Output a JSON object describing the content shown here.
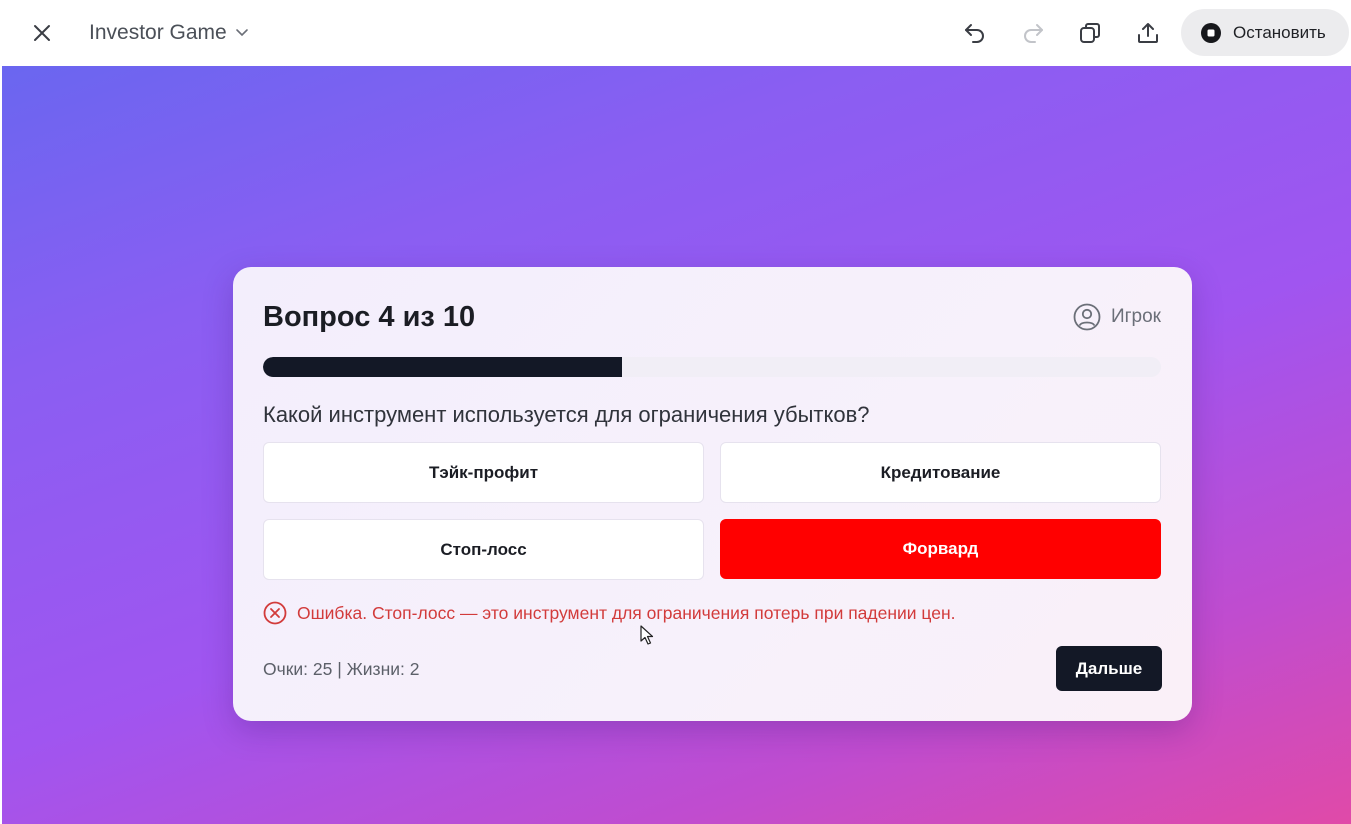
{
  "topbar": {
    "title": "Investor Game",
    "stop_label": "Остановить",
    "icons": [
      "close-icon",
      "chevron-down-icon",
      "undo-icon",
      "redo-icon",
      "copy-icon",
      "share-icon",
      "stop-icon"
    ]
  },
  "quiz": {
    "title": "Вопрос 4 из 10",
    "player_label": "Игрок",
    "progress_fraction": 0.4,
    "question": "Какой инструмент используется для ограничения убытков?",
    "options": [
      {
        "label": "Тэйк-профит",
        "state": "default"
      },
      {
        "label": "Кредитование",
        "state": "default"
      },
      {
        "label": "Стоп-лосс",
        "state": "default"
      },
      {
        "label": "Форвард",
        "state": "wrong"
      }
    ],
    "feedback": "Ошибка. Стоп-лосс — это инструмент для ограничения потерь при падении цен.",
    "score": "Очки: 25 | Жизни: 2",
    "next_label": "Дальше"
  },
  "colors": {
    "wrong_option": "#ff0000",
    "error_text": "#d23b3b",
    "dark": "#131826",
    "gradient_start": "#6a66f0",
    "gradient_end": "#e04aa8"
  }
}
